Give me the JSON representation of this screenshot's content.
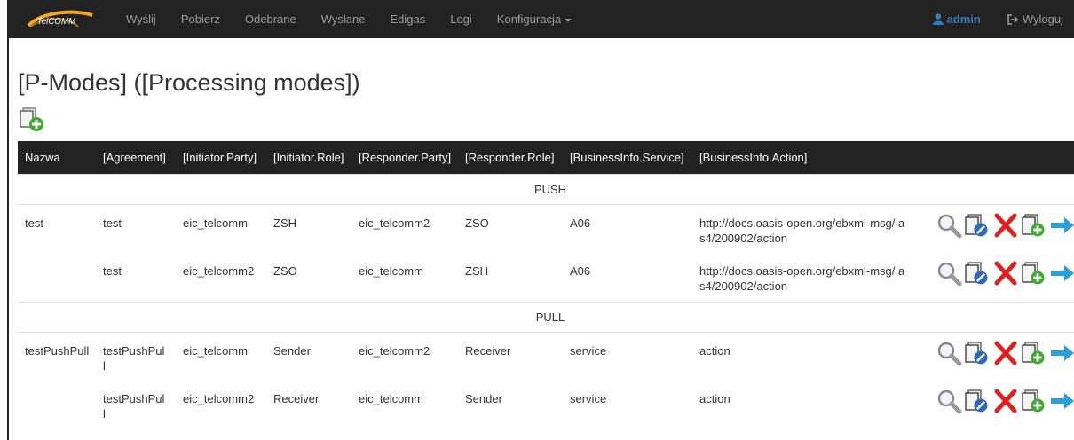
{
  "navbar": {
    "brand": "TelCOMM",
    "links": [
      "Wyślij",
      "Pobierz",
      "Odebrane",
      "Wysłane",
      "Edigas",
      "Logi",
      "Konfiguracja"
    ],
    "user": "admin",
    "logout": "Wyloguj"
  },
  "page": {
    "title": "[P-Modes] ([Processing modes])"
  },
  "table": {
    "headers": [
      "Nazwa",
      "[Agreement]",
      "[Initiator.Party]",
      "[Initiator.Role]",
      "[Responder.Party]",
      "[Responder.Role]",
      "[BusinessInfo.Service]",
      "[BusinessInfo.Action]"
    ],
    "groups": [
      {
        "label": "PUSH",
        "rows": [
          {
            "name": "test",
            "agreement": "test",
            "initiator_party": "eic_telcomm",
            "initiator_role": "ZSH",
            "responder_party": "eic_telcomm2",
            "responder_role": "ZSO",
            "service": "A06",
            "action": "http://docs.oasis-open.org/ebxml-msg/ as4/200902/action"
          },
          {
            "name": "",
            "agreement": "test",
            "initiator_party": "eic_telcomm2",
            "initiator_role": "ZSO",
            "responder_party": "eic_telcomm",
            "responder_role": "ZSH",
            "service": "A06",
            "action": "http://docs.oasis-open.org/ebxml-msg/ as4/200902/action"
          }
        ]
      },
      {
        "label": "PULL",
        "rows": [
          {
            "name": "testPushPull",
            "agreement": "testPushPul l",
            "initiator_party": "eic_telcomm",
            "initiator_role": "Sender",
            "responder_party": "eic_telcomm2",
            "responder_role": "Receiver",
            "service": "service",
            "action": "action"
          },
          {
            "name": "",
            "agreement": "testPushPul l",
            "initiator_party": "eic_telcomm2",
            "initiator_role": "Receiver",
            "responder_party": "eic_telcomm",
            "responder_role": "Sender",
            "service": "service",
            "action": "action"
          }
        ]
      }
    ]
  },
  "icons": {
    "view": "magnifier-icon",
    "edit": "edit-document-icon",
    "delete": "red-x-icon",
    "copy": "add-document-icon",
    "export": "blue-arrow-icon"
  },
  "colors": {
    "navbar_bg": "#222222",
    "nav_text": "#9d9d9d",
    "admin": "#337ab7",
    "delete": "#e0201c",
    "add_green": "#3dab2e",
    "arrow_blue": "#2b9fd8"
  }
}
